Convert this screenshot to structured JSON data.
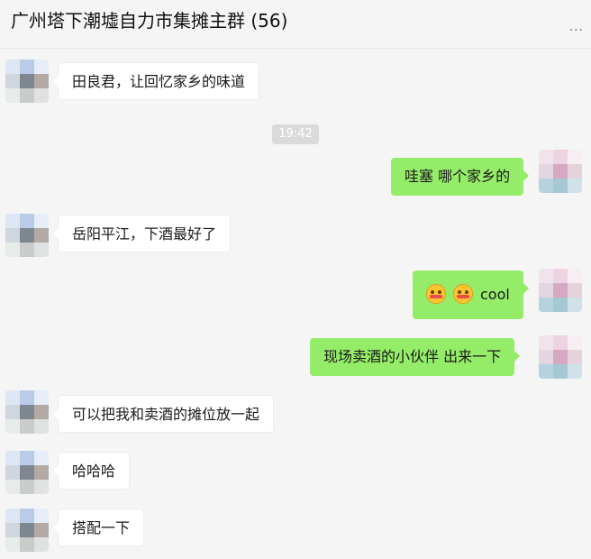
{
  "header": {
    "title": "广州塔下潮墟自力市集摊主群 (56)",
    "more_icon": "more-dots-icon",
    "more_glyph": "..."
  },
  "messages": [
    {
      "side": "incoming",
      "text": "田良君，让回忆家乡的味道"
    },
    {
      "type": "timestamp",
      "text": "19:42"
    },
    {
      "side": "outgoing",
      "text": "哇塞 哪个家乡的"
    },
    {
      "side": "incoming",
      "text": "岳阳平江，下酒最好了"
    },
    {
      "side": "outgoing",
      "text": "cool",
      "emojis": [
        "smile-face-emoji",
        "smile-face-emoji"
      ]
    },
    {
      "side": "outgoing",
      "text": "现场卖酒的小伙伴 出来一下"
    },
    {
      "side": "incoming",
      "text": "可以把我和卖酒的摊位放一起"
    },
    {
      "side": "incoming",
      "text": "哈哈哈"
    },
    {
      "side": "incoming",
      "text": "搭配一下"
    }
  ],
  "colors": {
    "background": "#f5f5f5",
    "incoming_bubble": "#ffffff",
    "outgoing_bubble": "#95ec69",
    "timestamp_bg": "#dadada"
  }
}
